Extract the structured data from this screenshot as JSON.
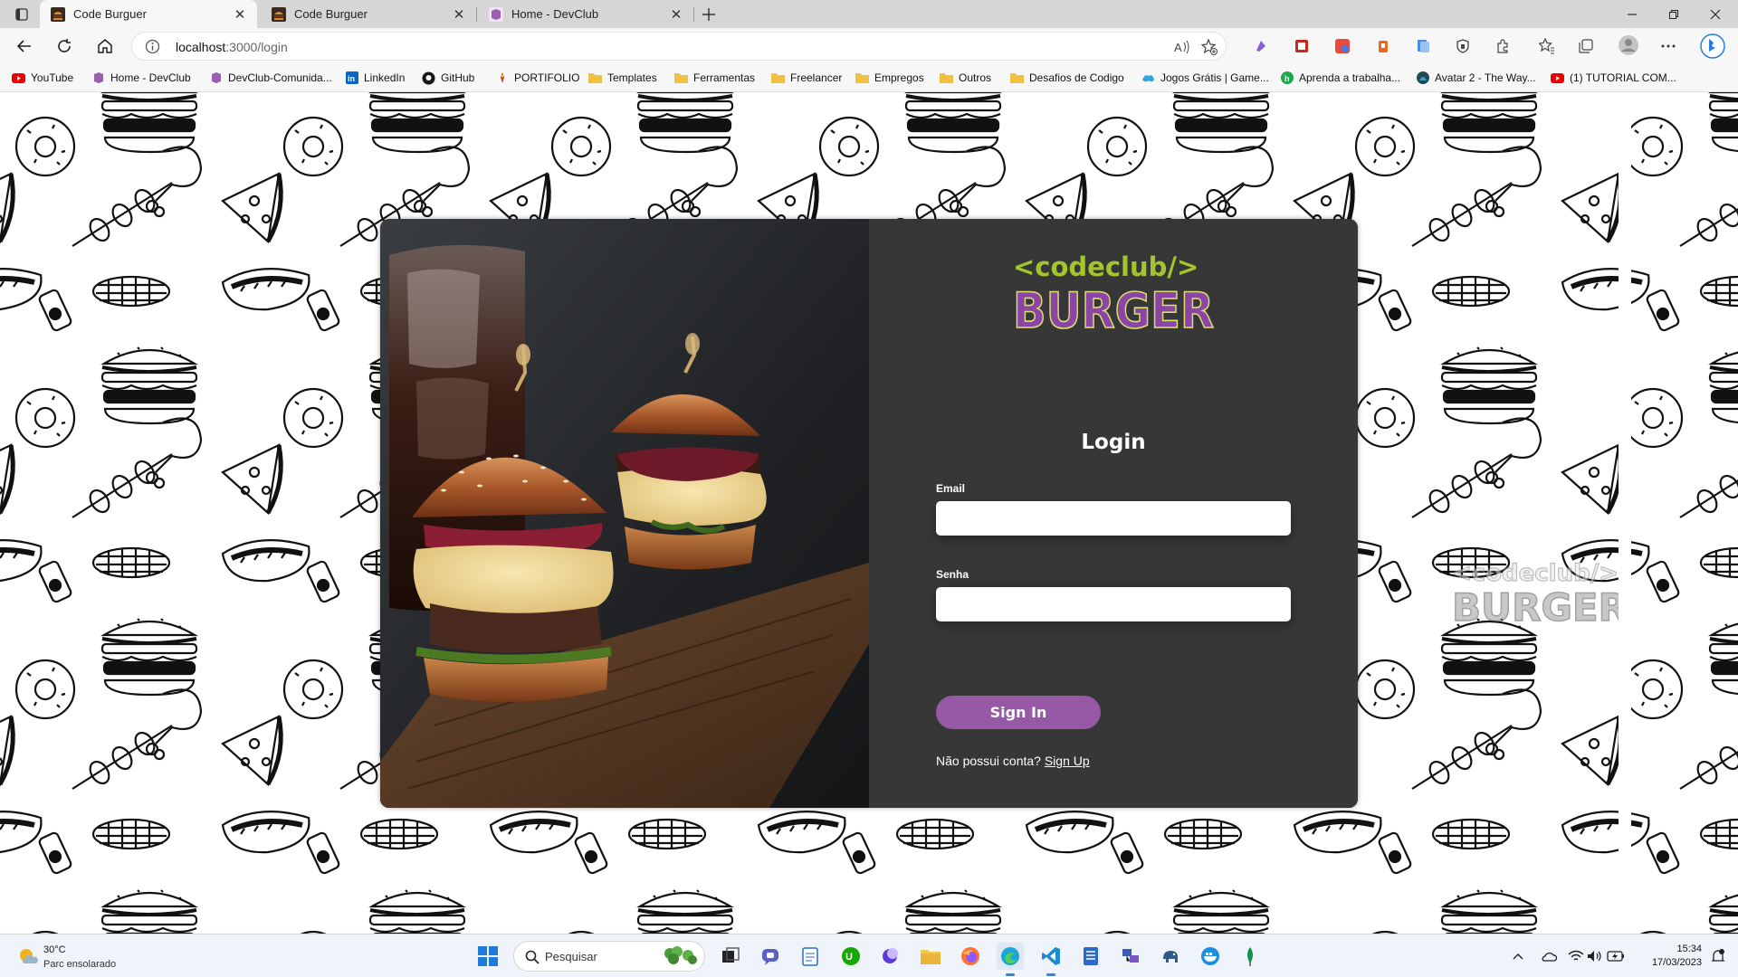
{
  "browser": {
    "tabs": [
      {
        "title": "Code Burguer",
        "active": true
      },
      {
        "title": "Code Burguer",
        "active": false
      },
      {
        "title": "Home - DevClub",
        "active": false
      }
    ],
    "address": {
      "host": "localhost",
      "rest": ":3000/login"
    },
    "bookmarks": [
      {
        "label": "YouTube",
        "icon": "youtube-icon"
      },
      {
        "label": "Home - DevClub",
        "icon": "devclub-icon"
      },
      {
        "label": "DevClub-Comunida...",
        "icon": "devclub-icon"
      },
      {
        "label": "LinkedIn",
        "icon": "linkedin-icon"
      },
      {
        "label": "GitHub",
        "icon": "github-icon"
      },
      {
        "label": "PORTIFOLIO",
        "icon": "portfolio-icon"
      },
      {
        "label": "Templates",
        "icon": "folder-icon"
      },
      {
        "label": "Ferramentas",
        "icon": "folder-icon"
      },
      {
        "label": "Freelancer",
        "icon": "folder-icon"
      },
      {
        "label": "Empregos",
        "icon": "folder-icon"
      },
      {
        "label": "Outros",
        "icon": "folder-icon"
      },
      {
        "label": "Desafios de Codigo",
        "icon": "folder-icon"
      },
      {
        "label": "Jogos Grátis | Game...",
        "icon": "games-icon"
      },
      {
        "label": "Aprenda a trabalha...",
        "icon": "green-circle-icon"
      },
      {
        "label": "Avatar 2 - The Way...",
        "icon": "avatar-icon"
      },
      {
        "label": "(1) TUTORIAL COM...",
        "icon": "youtube-icon"
      }
    ]
  },
  "page": {
    "logo": {
      "top": "<codeclub/>",
      "bottom": "BURGER"
    },
    "login": {
      "title": "Login",
      "email_label": "Email",
      "email_value": "",
      "password_label": "Senha",
      "password_value": "",
      "submit": "Sign In",
      "no_account": "Não possui conta?",
      "signup_link": "Sign Up"
    }
  },
  "colors": {
    "accent_purple": "#9758a6",
    "logo_green": "#9fc52b",
    "card_bg": "#373737"
  },
  "taskbar": {
    "weather": {
      "temp": "30°C",
      "condition": "Parc ensolarado"
    },
    "search_placeholder": "Pesquisar",
    "time": "15:34",
    "date": "17/03/2023"
  }
}
